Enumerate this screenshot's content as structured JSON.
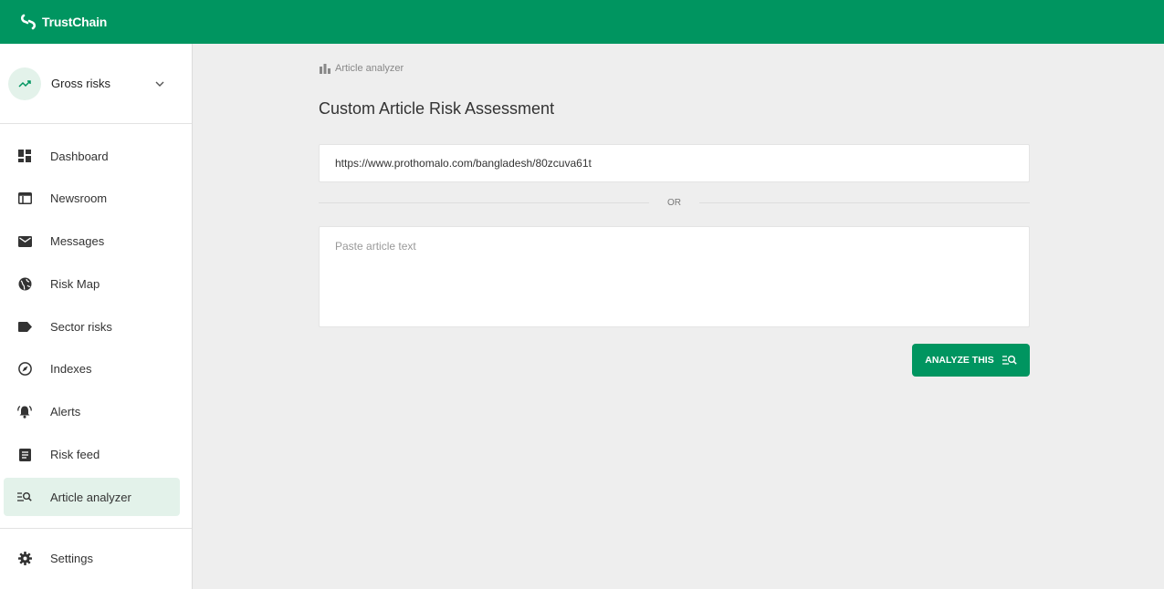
{
  "app": {
    "brand": "TrustChain"
  },
  "sidebar": {
    "selector_label": "Gross risks",
    "items": [
      {
        "label": "Dashboard",
        "icon": "dashboard-icon"
      },
      {
        "label": "Newsroom",
        "icon": "newsroom-icon"
      },
      {
        "label": "Messages",
        "icon": "mail-icon"
      },
      {
        "label": "Risk Map",
        "icon": "globe-icon"
      },
      {
        "label": "Sector risks",
        "icon": "label-icon"
      },
      {
        "label": "Indexes",
        "icon": "compass-icon"
      },
      {
        "label": "Alerts",
        "icon": "bell-icon"
      },
      {
        "label": "Risk feed",
        "icon": "feed-icon"
      },
      {
        "label": "Article analyzer",
        "icon": "article-search-icon",
        "active": true
      }
    ],
    "settings_label": "Settings"
  },
  "main": {
    "breadcrumb": "Article analyzer",
    "title": "Custom Article Risk Assessment",
    "url_value": "https://www.prothomalo.com/bangladesh/80zcuva61t",
    "or_text": "OR",
    "text_placeholder": "Paste article text",
    "analyze_label": "ANALYZE THIS"
  },
  "colors": {
    "brand": "#009560",
    "active_bg": "#e3f2ea",
    "background": "#eeeeee"
  }
}
